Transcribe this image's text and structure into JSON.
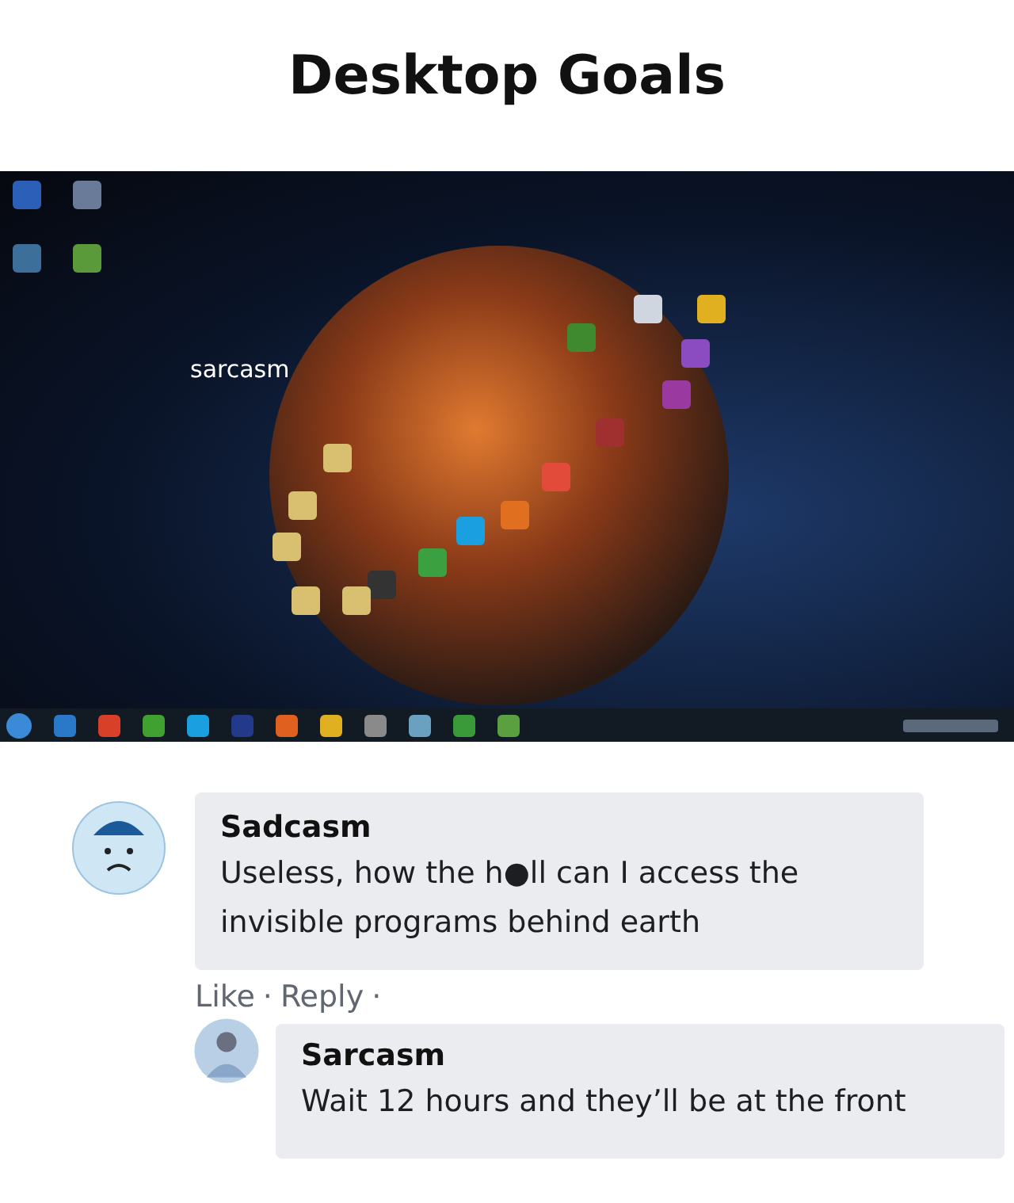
{
  "title": "Desktop Goals",
  "desktop": {
    "wallpaper_text": "sarcasm"
  },
  "comments": [
    {
      "name": "Sadcasm",
      "text": "Useless, how the h●ll can I access the invisible programs behind earth",
      "kind": "cartoon",
      "actions": [
        "Like",
        "Reply"
      ],
      "separator": "·",
      "replies": [
        {
          "name": "Sarcasm",
          "text": "Wait 12 hours and they’ll be at the front",
          "kind": "photo"
        }
      ]
    }
  ]
}
